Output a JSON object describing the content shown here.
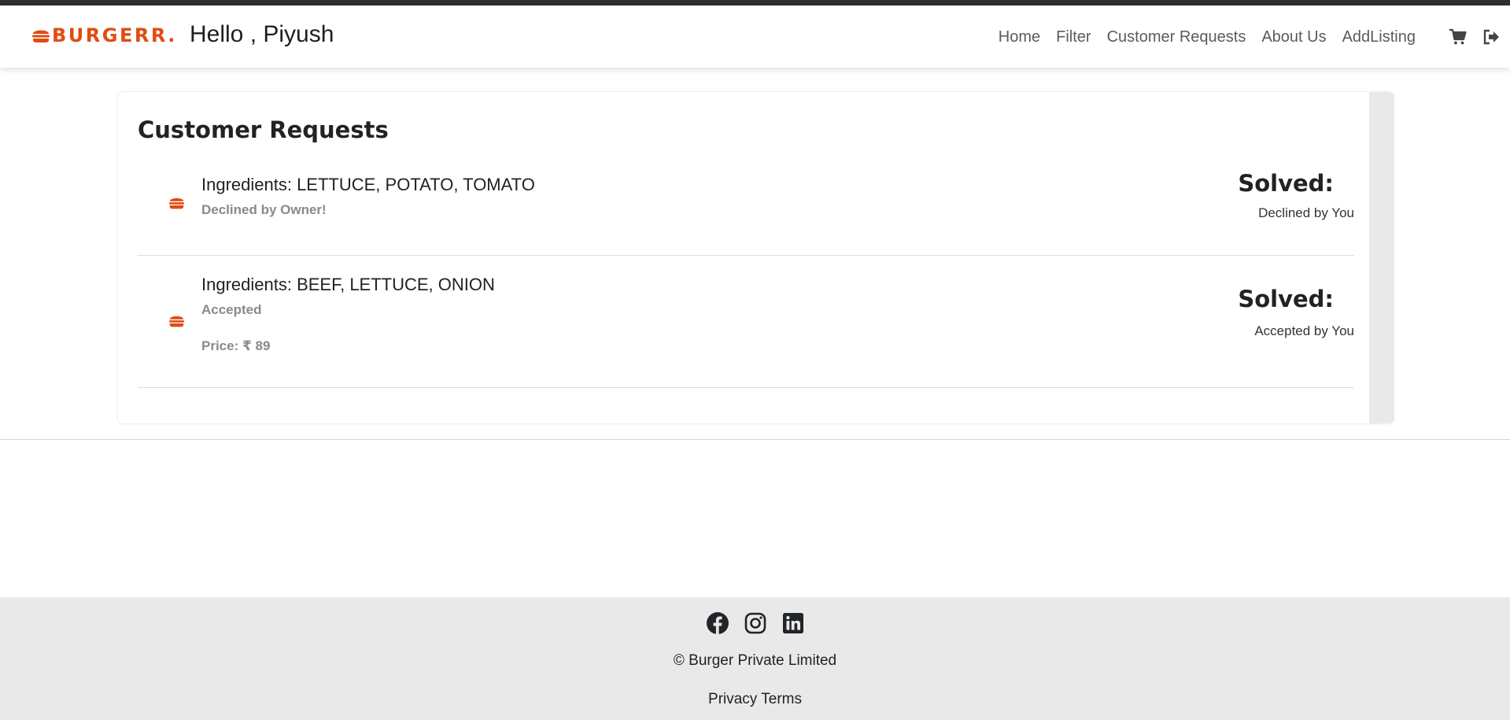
{
  "header": {
    "brand": "BURGERR.",
    "greeting": "Hello , Piyush",
    "nav": [
      {
        "label": "Home"
      },
      {
        "label": "Filter"
      },
      {
        "label": "Customer Requests"
      },
      {
        "label": "About Us"
      },
      {
        "label": "AddListing"
      }
    ],
    "icons": [
      "cart-icon",
      "logout-icon"
    ]
  },
  "page": {
    "title": "Customer Requests",
    "requests": [
      {
        "ingredients": "Ingredients: LETTUCE, POTATO, TOMATO",
        "status": "Declined by Owner!",
        "price": "",
        "solved_label": "Solved:",
        "solved_note": "Declined by You"
      },
      {
        "ingredients": "Ingredients: BEEF, LETTUCE, ONION",
        "status": "Accepted",
        "price": "Price: ₹ 89",
        "solved_label": "Solved:",
        "solved_note": "Accepted by You"
      }
    ]
  },
  "footer": {
    "socials": [
      "facebook-icon",
      "instagram-icon",
      "linkedin-icon"
    ],
    "copyright": "© Burger Private Limited",
    "privacy": "Privacy",
    "terms": "Terms"
  },
  "colors": {
    "accent": "#e14b13",
    "topstrip": "#2f2f2f",
    "footer_bg": "#e9e9e9",
    "muted_text": "#8a8a8a"
  }
}
